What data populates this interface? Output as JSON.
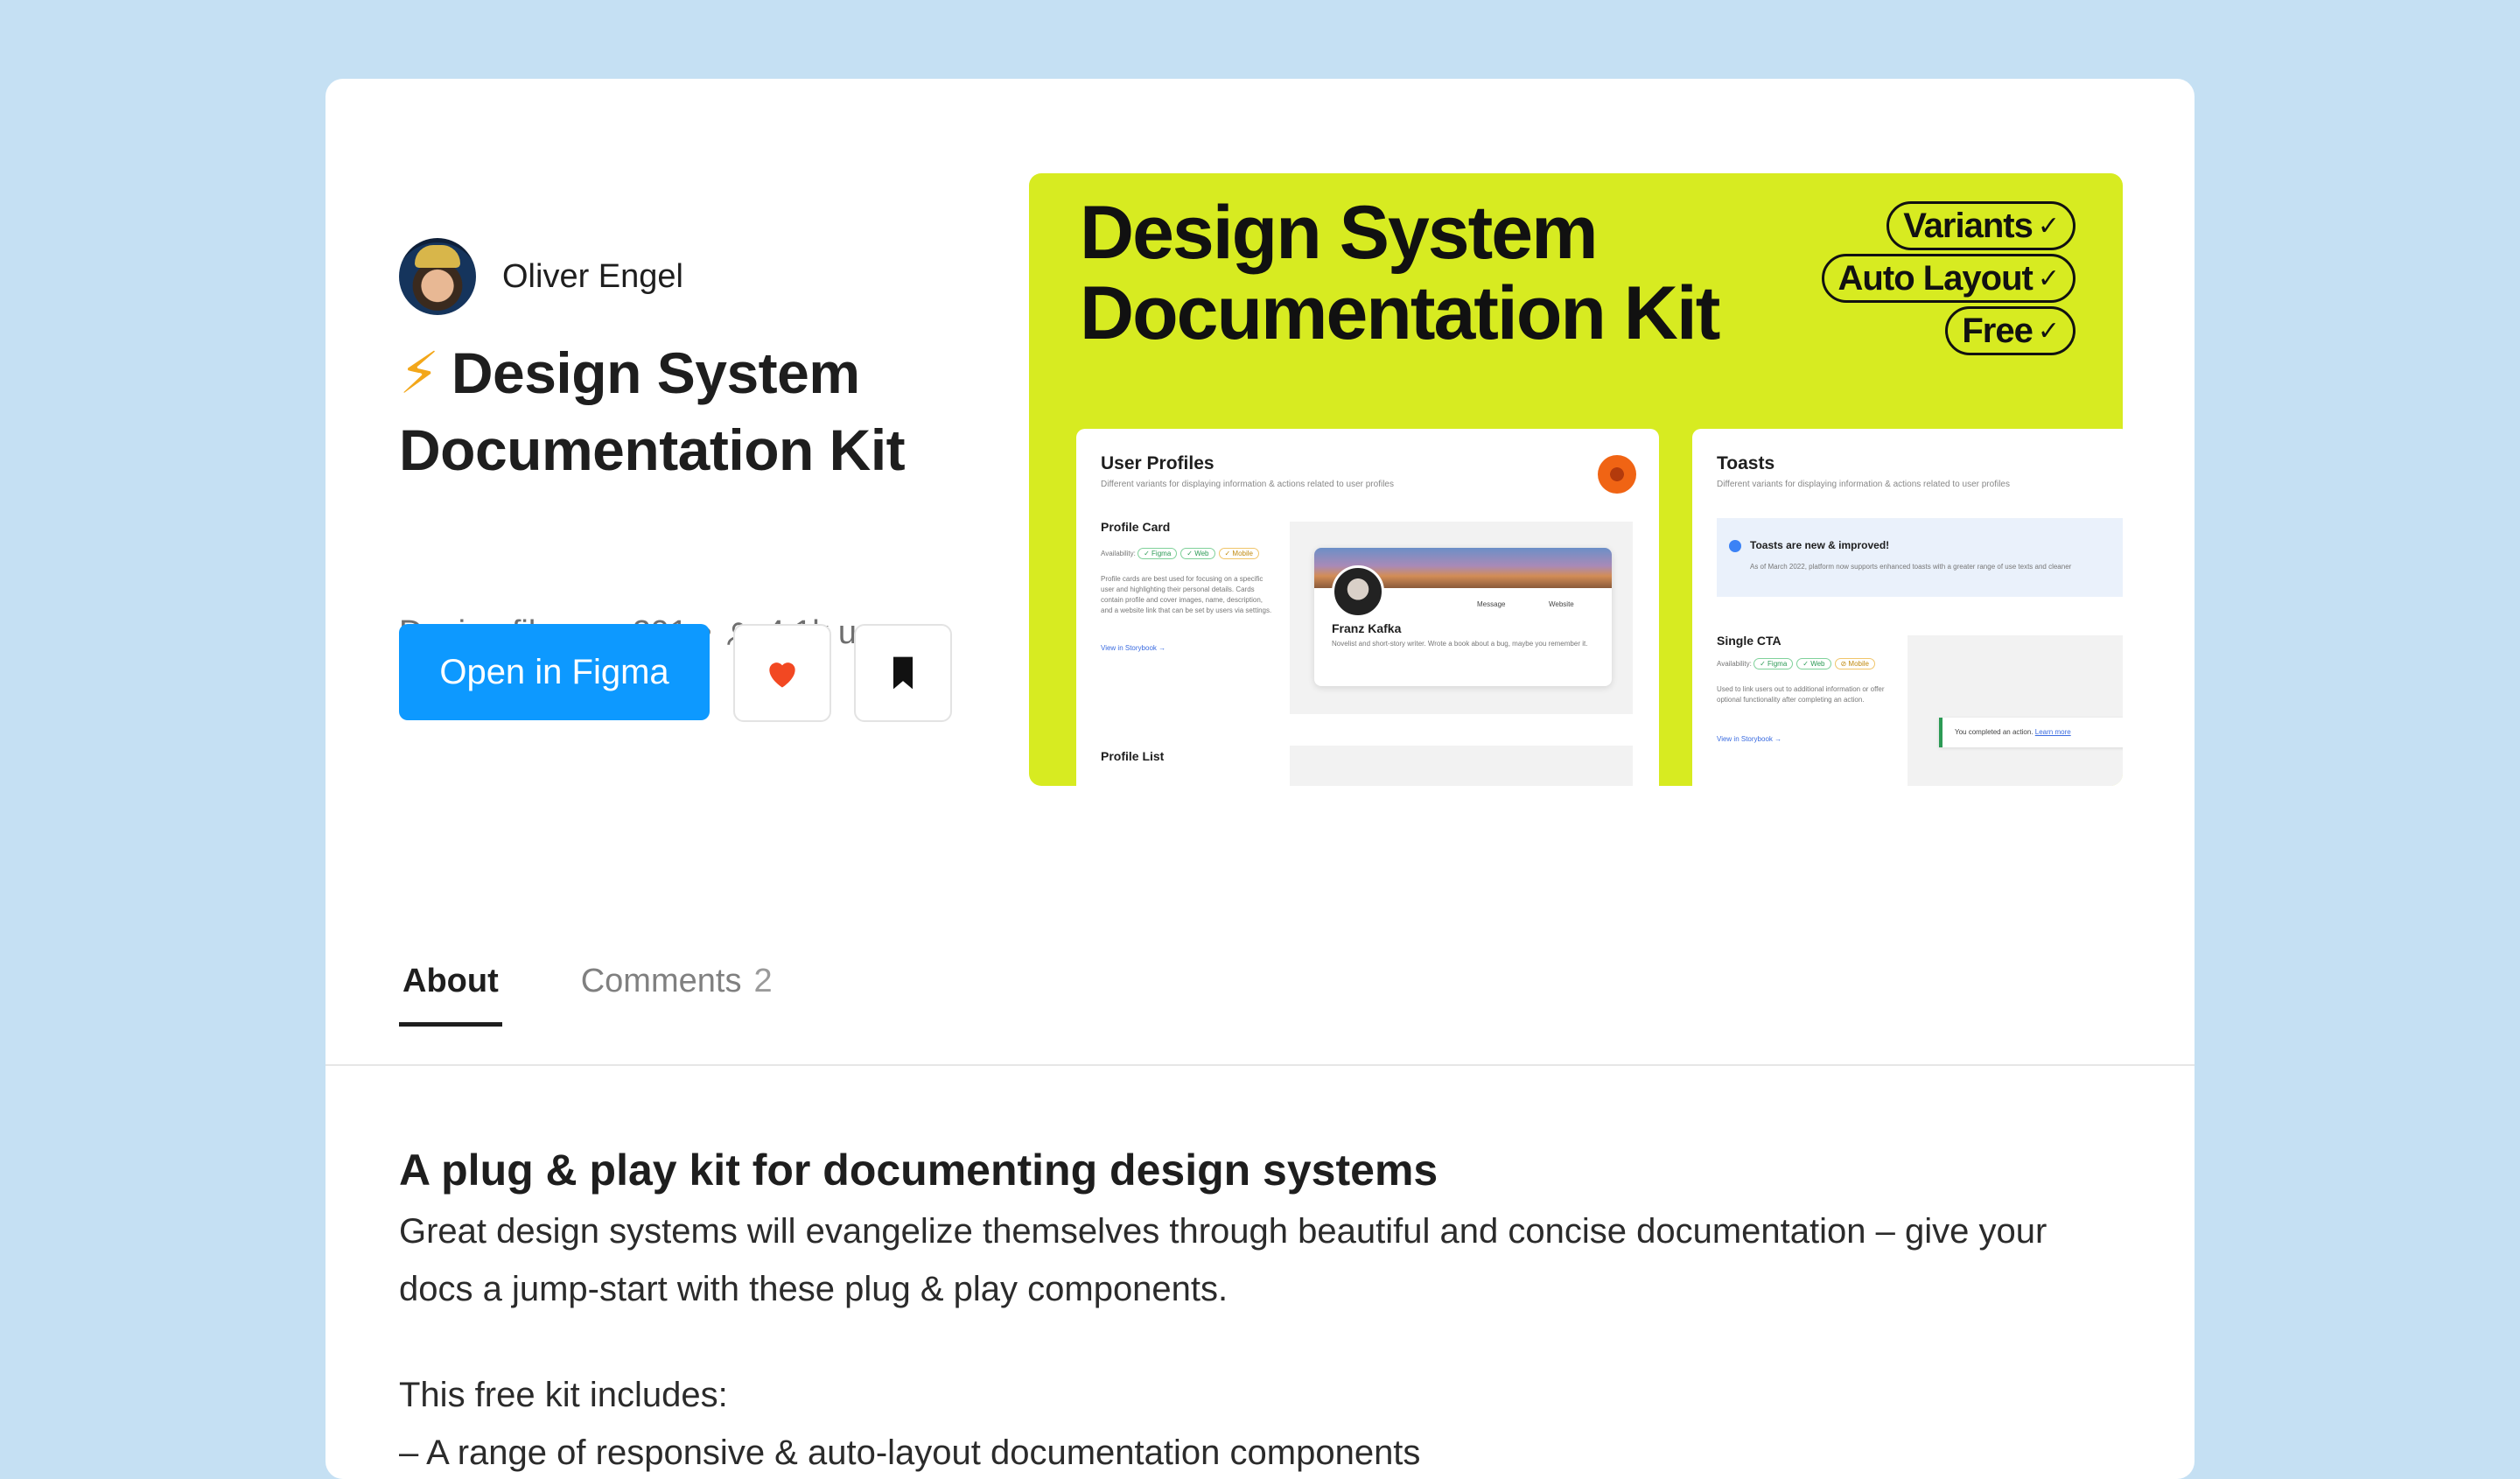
{
  "author": {
    "name": "Oliver Engel"
  },
  "file": {
    "title_icon": "⚡",
    "title_line1": "Design System",
    "title_line2": "Documentation Kit",
    "type": "Design file",
    "likes": "291",
    "users": "4.1k users",
    "separator": "•"
  },
  "actions": {
    "open_label": "Open in Figma"
  },
  "cover": {
    "title_line1": "Design System",
    "title_line2": "Documentation Kit",
    "pills": [
      "Variants",
      "Auto Layout",
      "Free"
    ],
    "check": "✓",
    "panel_profiles": {
      "title": "User Profiles",
      "subtitle": "Different variants for displaying information & actions related to user profiles",
      "section1": "Profile Card",
      "availability": "Availability:",
      "tags": [
        "✓ Figma",
        "✓ Web",
        "✓ Mobile"
      ],
      "description": "Profile cards are best used for focusing on a specific user and highlighting their personal details. Cards contain profile and cover images, name, description, and a website link that can be set by users via settings.",
      "link": "View in Storybook →",
      "person_name": "Franz Kafka",
      "person_bio": "Novelist and short-story writer. Wrote a book about a bug, maybe you remember it.",
      "message_btn": "Message",
      "website_btn": "Website",
      "section2": "Profile List"
    },
    "panel_toasts": {
      "title": "Toasts",
      "subtitle": "Different variants for displaying information & actions related to user profiles",
      "banner_title": "Toasts are new & improved!",
      "banner_text": "As of March 2022, platform now supports enhanced toasts with a greater range of use texts and cleaner",
      "section": "Single CTA",
      "availability": "Availability:",
      "tags": [
        "✓ Figma",
        "✓ Web",
        "⊘ Mobile"
      ],
      "description": "Used to link users out to additional information or offer optional functionality after completing an action.",
      "link": "View in Storybook →",
      "toast_text": "You completed an action.",
      "toast_link": "Learn more"
    }
  },
  "tabs": [
    {
      "label": "About",
      "active": true
    },
    {
      "label": "Comments",
      "count": "2",
      "active": false
    }
  ],
  "about": {
    "heading": "A plug & play kit for documenting design systems",
    "paragraph": "Great design systems will evangelize themselves through beautiful and concise documentation – give your docs a jump-start with these plug & play components.",
    "kit_intro": "This free kit includes:",
    "kit_items": [
      "– A range of responsive & auto-layout documentation components"
    ]
  },
  "colors": {
    "page_bg": "#c5e0f3",
    "primary": "#0d99ff",
    "cover_bg": "#d7eb21",
    "heart": "#f24822"
  }
}
